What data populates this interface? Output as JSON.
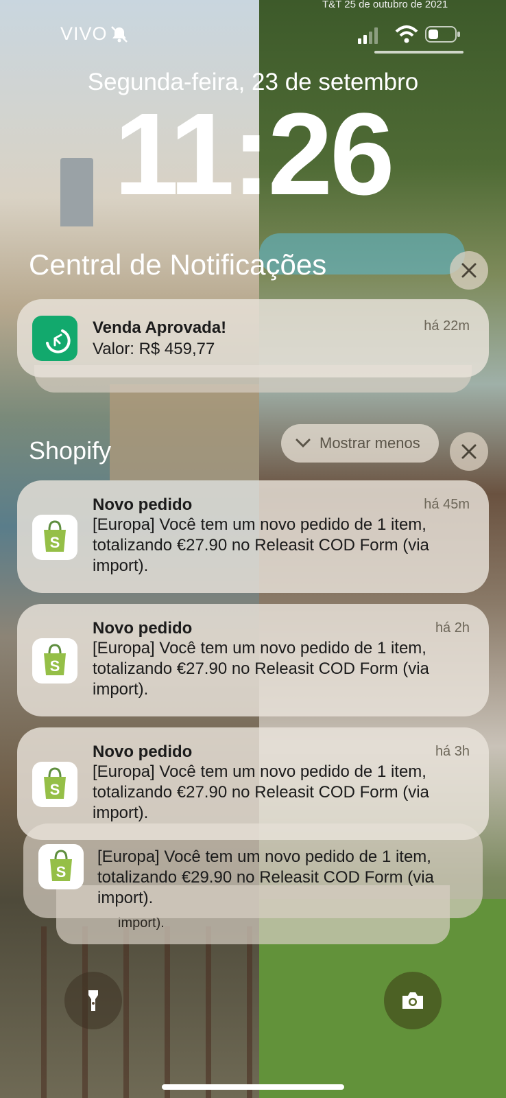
{
  "status_bar": {
    "carrier": "VIVO",
    "corner_text": "T&T 25 de outubro de 2021"
  },
  "lockscreen": {
    "date": "Segunda-feira, 23 de setembro",
    "time": "11:26"
  },
  "notification_center": {
    "title": "Central de Notificações"
  },
  "sale_notification": {
    "title": "Venda Aprovada!",
    "body": "Valor: R$ 459,77",
    "time": "há 22m",
    "icon": "sale-app-icon",
    "icon_color": "#12a96d"
  },
  "shopify_group": {
    "title": "Shopify",
    "show_less_label": "Mostrar menos",
    "icon_color": "#95bf47",
    "notifications": [
      {
        "title": "Novo pedido",
        "time": "há 45m",
        "body": "[Europa] Você tem um novo pedido de 1 item, totalizando €27.90 no Releasit COD Form (via import)."
      },
      {
        "title": "Novo pedido",
        "time": "há 2h",
        "body": "[Europa] Você tem um novo pedido de 1 item, totalizando €27.90 no Releasit COD Form (via import)."
      },
      {
        "title": "Novo pedido",
        "time": "há 3h",
        "body": "[Europa] Você tem um novo pedido de 1 item, totalizando €27.90 no Releasit COD Form (via import)."
      }
    ],
    "stacked": {
      "body": "[Europa] Você tem um novo pedido de 1 item, totalizando €29.90 no Releasit COD Form (via import).",
      "peek_text": "import)."
    }
  },
  "controls": {
    "flashlight": "flashlight-icon",
    "camera": "camera-icon"
  }
}
